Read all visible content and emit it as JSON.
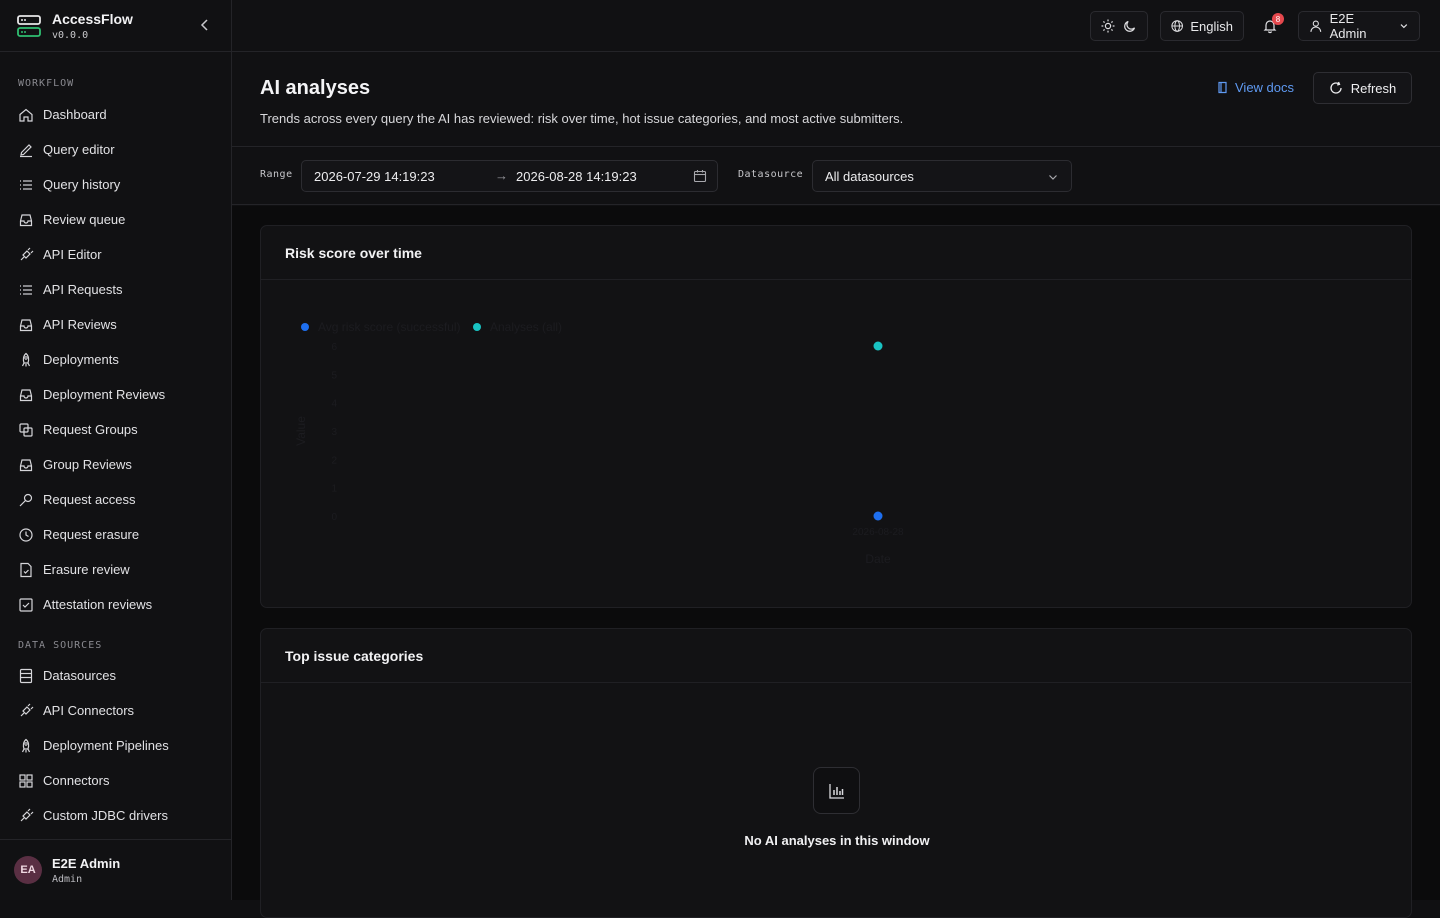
{
  "app": {
    "name": "AccessFlow",
    "version": "v0.0.0"
  },
  "sidebar": {
    "sections": [
      {
        "label": "WORKFLOW",
        "items": [
          {
            "label": "Dashboard",
            "icon": "home-icon"
          },
          {
            "label": "Query editor",
            "icon": "pencil-icon"
          },
          {
            "label": "Query history",
            "icon": "list-icon"
          },
          {
            "label": "Review queue",
            "icon": "inbox-icon"
          },
          {
            "label": "API Editor",
            "icon": "plug-icon"
          },
          {
            "label": "API Requests",
            "icon": "list-icon"
          },
          {
            "label": "API Reviews",
            "icon": "inbox-icon"
          },
          {
            "label": "Deployments",
            "icon": "rocket-icon"
          },
          {
            "label": "Deployment Reviews",
            "icon": "inbox-icon"
          },
          {
            "label": "Request Groups",
            "icon": "copy-icon"
          },
          {
            "label": "Group Reviews",
            "icon": "inbox-icon"
          },
          {
            "label": "Request access",
            "icon": "key-icon"
          },
          {
            "label": "Request erasure",
            "icon": "clock-icon"
          },
          {
            "label": "Erasure review",
            "icon": "file-check-icon"
          },
          {
            "label": "Attestation reviews",
            "icon": "checkbox-icon"
          }
        ]
      },
      {
        "label": "DATA SOURCES",
        "items": [
          {
            "label": "Datasources",
            "icon": "database-icon"
          },
          {
            "label": "API Connectors",
            "icon": "plug-icon"
          },
          {
            "label": "Deployment Pipelines",
            "icon": "rocket-icon"
          },
          {
            "label": "Connectors",
            "icon": "grid-icon"
          },
          {
            "label": "Custom JDBC drivers",
            "icon": "plug-icon"
          }
        ]
      }
    ],
    "footer": {
      "initials": "EA",
      "name": "E2E Admin",
      "role": "Admin"
    }
  },
  "topbar": {
    "language": "English",
    "notifications_count": "8",
    "user": "E2E Admin"
  },
  "header": {
    "title": "AI analyses",
    "subtitle": "Trends across every query the AI has reviewed: risk over time, hot issue categories, and most active submitters.",
    "docs_label": "View docs",
    "refresh_label": "Refresh"
  },
  "filters": {
    "range_label": "Range",
    "range_from": "2026-07-29 14:19:23",
    "range_to": "2026-08-28 14:19:23",
    "datasource_label": "Datasource",
    "datasource_value": "All datasources"
  },
  "risk_card": {
    "title": "Risk score over time"
  },
  "issues_card": {
    "title": "Top issue categories",
    "empty_text": "No AI analyses in this window"
  },
  "colors": {
    "avg_risk": "#1e6ff0",
    "analyses": "#19c3c3",
    "link": "#5f9af2",
    "badge": "#e5484d"
  },
  "chart_data": {
    "type": "scatter",
    "title": "Risk score over time",
    "xlabel": "Date",
    "ylabel": "Value",
    "legend_position": "top-left",
    "series": [
      {
        "name": "Avg risk score (successful)",
        "color": "#1e6ff0",
        "points": [
          {
            "x": "2026-08-28",
            "y": 0
          }
        ]
      },
      {
        "name": "Analyses (all)",
        "color": "#19c3c3",
        "points": [
          {
            "x": "2026-08-28",
            "y": 6
          }
        ]
      }
    ],
    "ylim": [
      0,
      6
    ],
    "yticks": [
      0,
      1,
      2,
      3,
      4,
      5,
      6
    ],
    "xticks": [
      "2026-08-28"
    ]
  }
}
